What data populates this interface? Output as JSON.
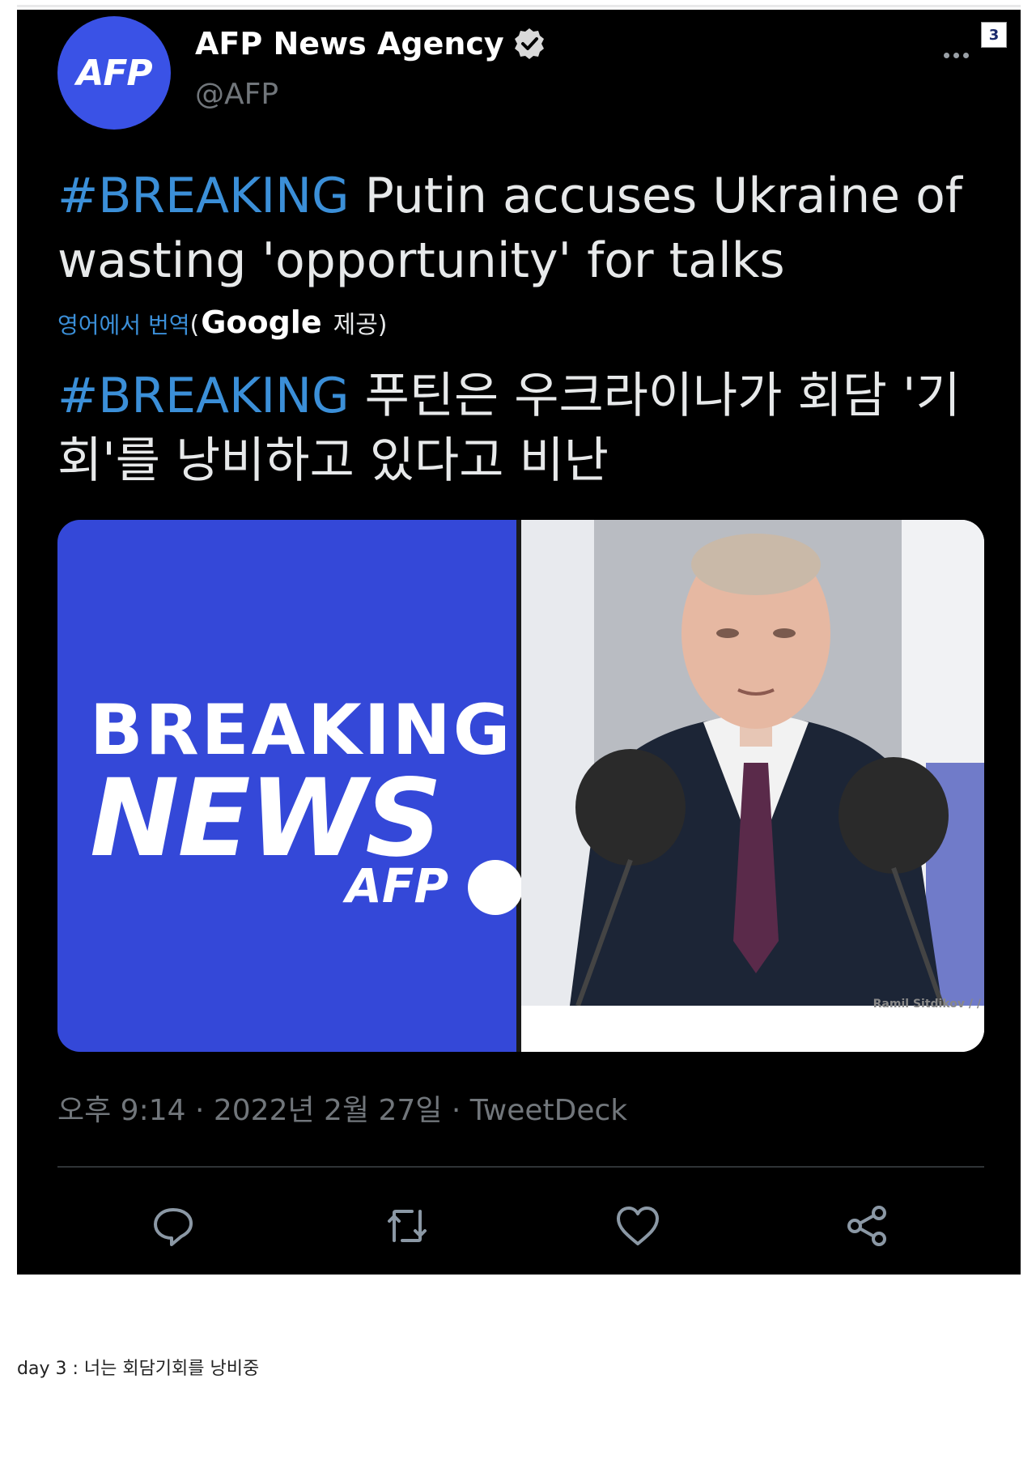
{
  "tweet": {
    "avatar_text": "AFP",
    "display_name": "AFP News Agency",
    "handle": "@AFP",
    "page_badge": "3",
    "hashtag": "#BREAKING",
    "text_rest": " Putin accuses Ukraine of wasting 'opportunity' for talks",
    "translate": {
      "link": "영어에서 번역",
      "paren_open": "(",
      "google": "Google",
      "provided": "제공)"
    },
    "translated_hashtag": "#BREAKING",
    "translated_rest": " 푸틴은 우크라이나가 회담 '기회'를 낭비하고 있다고 비난",
    "media": {
      "breaking": "BREAKING",
      "news": "NEWS",
      "afp": "AFP",
      "credit": "Ramil Sitdikov / /"
    },
    "meta": "오후 9:14 · 2022년 2월 27일 · TweetDeck",
    "actions": {
      "reply": "reply-icon",
      "retweet": "retweet-icon",
      "like": "heart-icon",
      "share": "share-icon"
    }
  },
  "caption": "day 3 : 너는 회담기회를 낭비중",
  "colors": {
    "background": "#000000",
    "hashtag": "#3b8fd8",
    "avatar": "#3a52e6",
    "muted": "#71767b"
  }
}
